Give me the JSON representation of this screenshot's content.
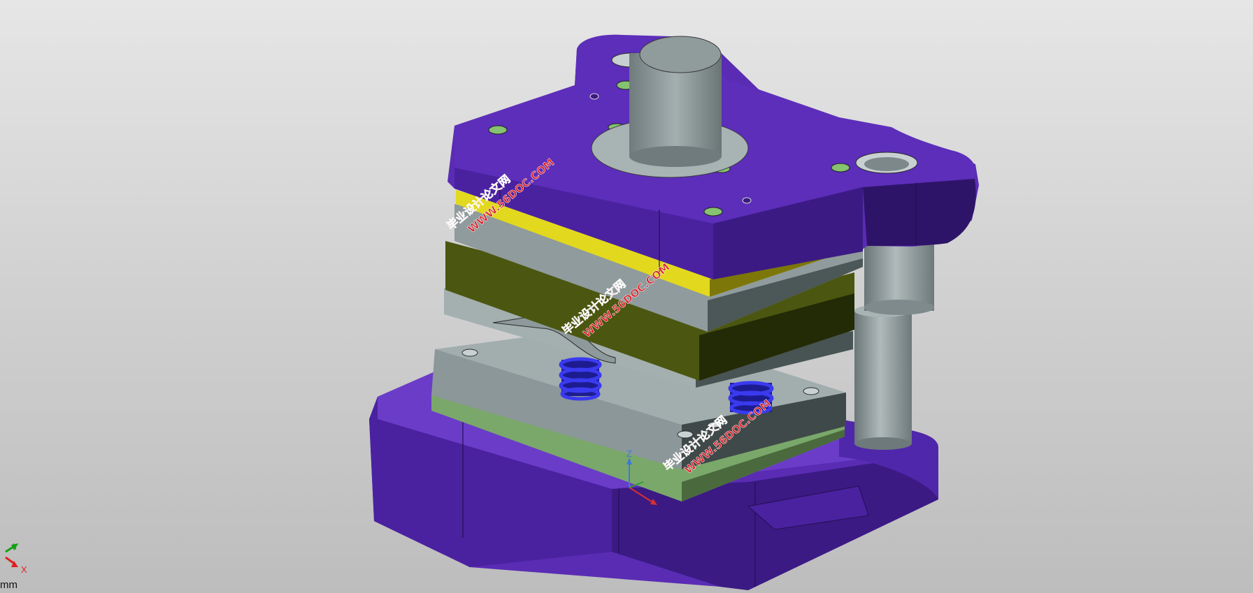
{
  "viewport": {
    "units_label": "mm",
    "triad_axes": [
      "Y",
      "X"
    ],
    "origin_axis_label": "Z"
  },
  "watermarks": [
    {
      "line1": "毕业设计论文网",
      "line2": "WWW.56DOC.COM"
    },
    {
      "line1": "毕业设计论文网",
      "line2": "WWW.56DOC.COM"
    },
    {
      "line1": "毕业设计论文网",
      "line2": "WWW.56DOC.COM"
    }
  ],
  "colors": {
    "plate_purple": "#5228a8",
    "plate_purple_dark": "#3a1a80",
    "steel_gray": "#8a9697",
    "yellow_plate": "#e0d51c",
    "olive_plate": "#4b5610",
    "green_plate": "#7aa86a",
    "spring_blue": "#2a2ad8",
    "watermark_red": "#d8242c"
  }
}
